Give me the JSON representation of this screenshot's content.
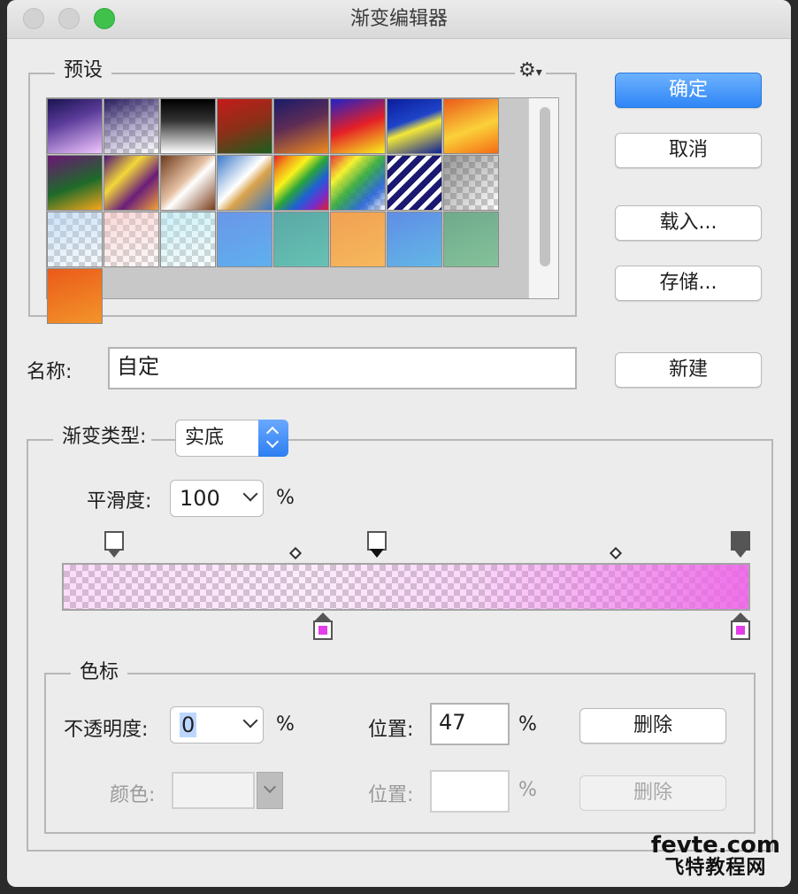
{
  "window": {
    "title": "渐变编辑器"
  },
  "presets": {
    "title": "预设",
    "gear_icon": "gear-icon",
    "swatches": [
      "linear-gradient(160deg,#1a1250 0%,#5b3c9a 40%,#f1c6ff 100%)",
      "CHECK:linear-gradient(160deg,#2a1d5e 0%,rgba(60,40,120,0.4) 50%,rgba(255,255,255,0) 100%)",
      "linear-gradient(180deg,#000 0%,#333 40%,#fff 100%)",
      "linear-gradient(160deg,#c41b1b 0%,#8a3018 50%,#1b5d1d 100%)",
      "linear-gradient(160deg,#1a1b6b 0%,#5e2c55 45%,#f08a1d 100%)",
      "linear-gradient(160deg,#1f22c8 0%,#e41f27 50%,#f8f21d 100%)",
      "linear-gradient(160deg,#0b1d9c 0%,#1e44c8 40%,#f3e839 55%,#0b1d9c 100%)",
      "linear-gradient(160deg,#ea5a1a 0%,#fbd13a 55%,#f46c14 100%)",
      "linear-gradient(160deg,#6b1675 0%,#1e6a2a 55%,#f6a71a 100%)",
      "linear-gradient(135deg,#4c1476 0%,#f3d63a 35%,#6a1d7a 65%,#f3a437 100%)",
      "linear-gradient(135deg,#6e3a1c 0%,#e6c1a4 45%,#ffffff 55%,#7a3c1a 100%)",
      "linear-gradient(135deg,#3a78c9 0%,#ffffff 45%,#d9a24a 60%,#3a78c9 100%)",
      "linear-gradient(135deg,#e41f27,#f29a1b,#f8f21d,#29a53b,#1f5fd6,#7b2ac7,#e41f27)",
      "CHECK:linear-gradient(135deg,rgba(228,31,39,0.9),rgba(248,242,29,0.9),rgba(41,165,59,0.9),rgba(31,95,214,0.9),rgba(255,255,255,0))",
      "repeating-linear-gradient(135deg,#1a1870 0px,#1a1870 7px,#ffffff 7px,#ffffff 12px)",
      "CHECK:linear-gradient(135deg,rgba(80,80,80,0.6) 0%,rgba(255,255,255,0) 100%)",
      "CHECK:linear-gradient(160deg,rgba(170,205,240,0.6),rgba(200,225,245,0.15))",
      "CHECK:linear-gradient(160deg,rgba(245,190,190,0.6),rgba(250,220,220,0.15))",
      "CHECK:linear-gradient(160deg,rgba(170,230,240,0.6),rgba(210,240,245,0.15))",
      "linear-gradient(160deg,#6a96e8,#5fb0ee)",
      "linear-gradient(160deg,#5aa8a6,#66c2b3)",
      "linear-gradient(160deg,#f1a153,#f6b85c)",
      "linear-gradient(160deg,#5f8de6,#63b7e6)",
      "linear-gradient(160deg,#6faa8c,#84c29a)",
      "linear-gradient(160deg,#ea5a1a,#f3952a)"
    ]
  },
  "buttons": {
    "ok": "确定",
    "cancel": "取消",
    "load": "载入...",
    "save": "存储...",
    "new": "新建",
    "delete1": "删除",
    "delete2": "删除"
  },
  "name": {
    "label": "名称:",
    "value": "自定"
  },
  "gradient_type": {
    "label": "渐变类型:",
    "value": "实底"
  },
  "smoothness": {
    "label": "平滑度:",
    "value": "100",
    "unit": "%"
  },
  "stops": {
    "title": "色标",
    "opacity_label": "不透明度:",
    "opacity_value": "0",
    "opacity_unit": "%",
    "position_label1": "位置:",
    "position_value1": "47",
    "position_unit1": "%",
    "color_label": "颜色:",
    "position_label2": "位置:",
    "position_value2": "",
    "position_unit2": "%"
  },
  "colors": {
    "stop_color": "#e33ee9",
    "accent": "#2f86f6"
  },
  "watermark": {
    "line1": "fevte.com",
    "line2": "飞特教程网"
  }
}
